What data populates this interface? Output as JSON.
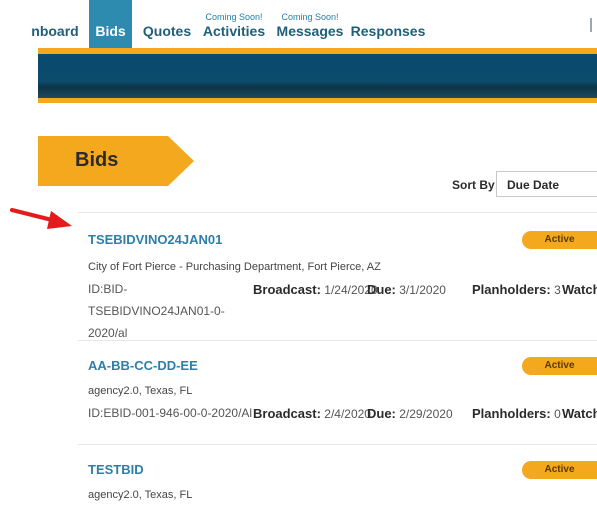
{
  "nav": {
    "items": [
      {
        "label": "nboard",
        "soon": ""
      },
      {
        "label": "Bids",
        "soon": ""
      },
      {
        "label": "Quotes",
        "soon": ""
      },
      {
        "label": "Activities",
        "soon": "Coming Soon!"
      },
      {
        "label": "Messages",
        "soon": "Coming Soon!"
      },
      {
        "label": "Responses",
        "soon": ""
      }
    ]
  },
  "page": {
    "heading": "Bids"
  },
  "sort": {
    "label": "Sort By",
    "selected": "Due Date"
  },
  "bids": [
    {
      "title": "TSEBIDVINO24JAN01",
      "status": "Active",
      "agency": "City of Fort Pierce - Purchasing Department, Fort Pierce, AZ",
      "id_label": "ID:",
      "id": "BID-TSEBIDVINO24JAN01-0-2020/al",
      "broadcast_label": "Broadcast:",
      "broadcast": "1/24/2020",
      "due_label": "Due:",
      "due": "3/1/2020",
      "planholders_label": "Planholders:",
      "planholders": "3",
      "watch_label": "Watch"
    },
    {
      "title": "AA-BB-CC-DD-EE",
      "status": "Active",
      "agency": "agency2.0, Texas, FL",
      "id_label": "ID:",
      "id": "EBID-001-946-00-0-2020/Al",
      "broadcast_label": "Broadcast:",
      "broadcast": "2/4/2020",
      "due_label": "Due:",
      "due": "2/29/2020",
      "planholders_label": "Planholders:",
      "planholders": "0",
      "watch_label": "Watch"
    },
    {
      "title": "TESTBID",
      "status": "Active",
      "agency": "agency2.0, Texas, FL"
    }
  ],
  "colors": {
    "accent": "#f4a81d",
    "nav_active": "#2e8bb0",
    "banner": "#0a4a6e",
    "link": "#2e7fa8",
    "annotation_arrow": "#e31b1b"
  }
}
